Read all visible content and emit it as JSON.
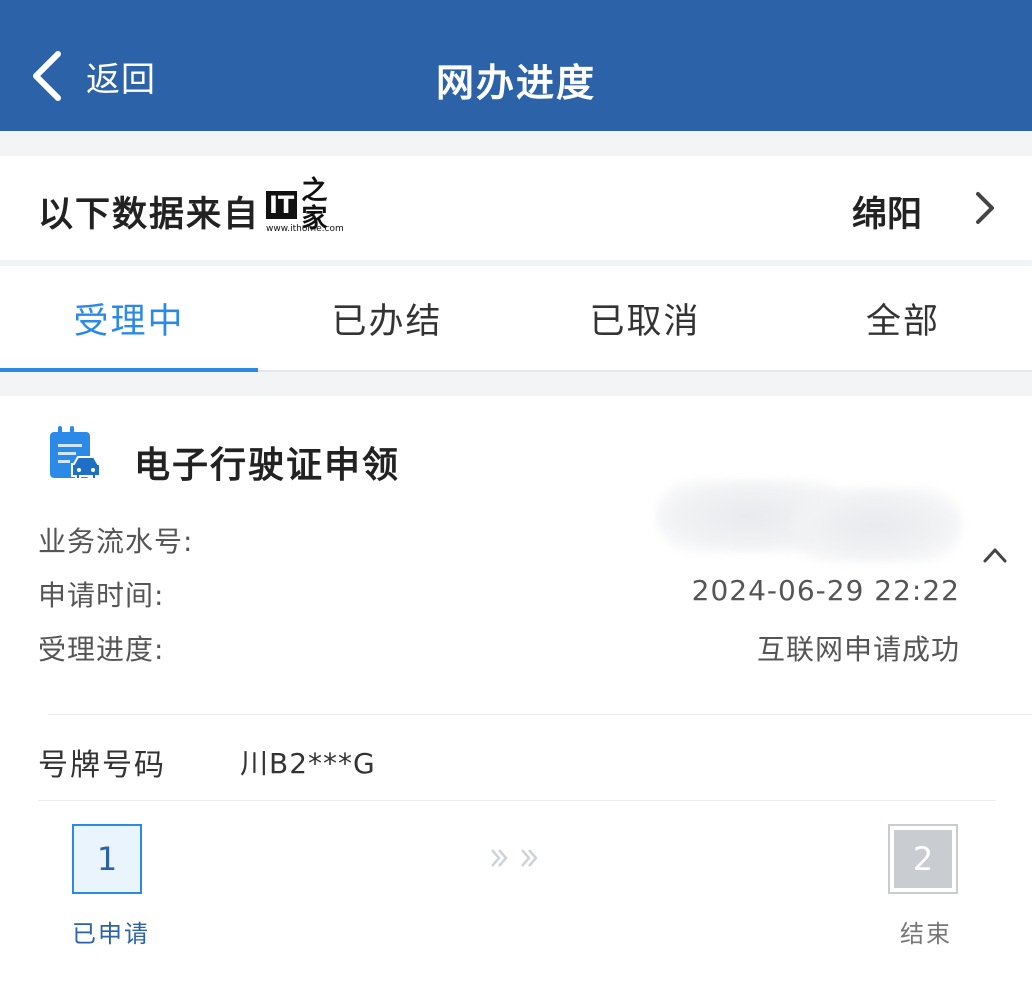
{
  "colors": {
    "header_bg": "#2b62a8",
    "accent": "#2b8ae8",
    "page_bg": "#f2f4f6"
  },
  "header": {
    "back_label": "返回",
    "title": "网办进度",
    "back_icon": "chevron-left-icon"
  },
  "source": {
    "text": "以下数据来自",
    "city": "绵阳",
    "city_icon": "chevron-right-icon",
    "watermark_it": "IT",
    "watermark_char": "之家",
    "watermark_url": "www.ithome.com"
  },
  "tabs": [
    {
      "label": "受理中",
      "active": true
    },
    {
      "label": "已办结",
      "active": false
    },
    {
      "label": "已取消",
      "active": false
    },
    {
      "label": "全部",
      "active": false
    }
  ],
  "card": {
    "icon": "document-car-icon",
    "title": "电子行驶证申领",
    "serial_label": "业务流水号:",
    "time_label": "申请时间:",
    "time_value": "2024-06-29 22:22",
    "progress_label": "受理进度:",
    "progress_value": "互联网申请成功",
    "plate_label": "号牌号码",
    "plate_value": "川B2***G",
    "collapse_icon": "chevron-up-icon"
  },
  "steps": [
    {
      "number": "1",
      "label": "已申请",
      "status": "done"
    },
    {
      "number": "2",
      "label": "结束",
      "status": "pending"
    }
  ]
}
